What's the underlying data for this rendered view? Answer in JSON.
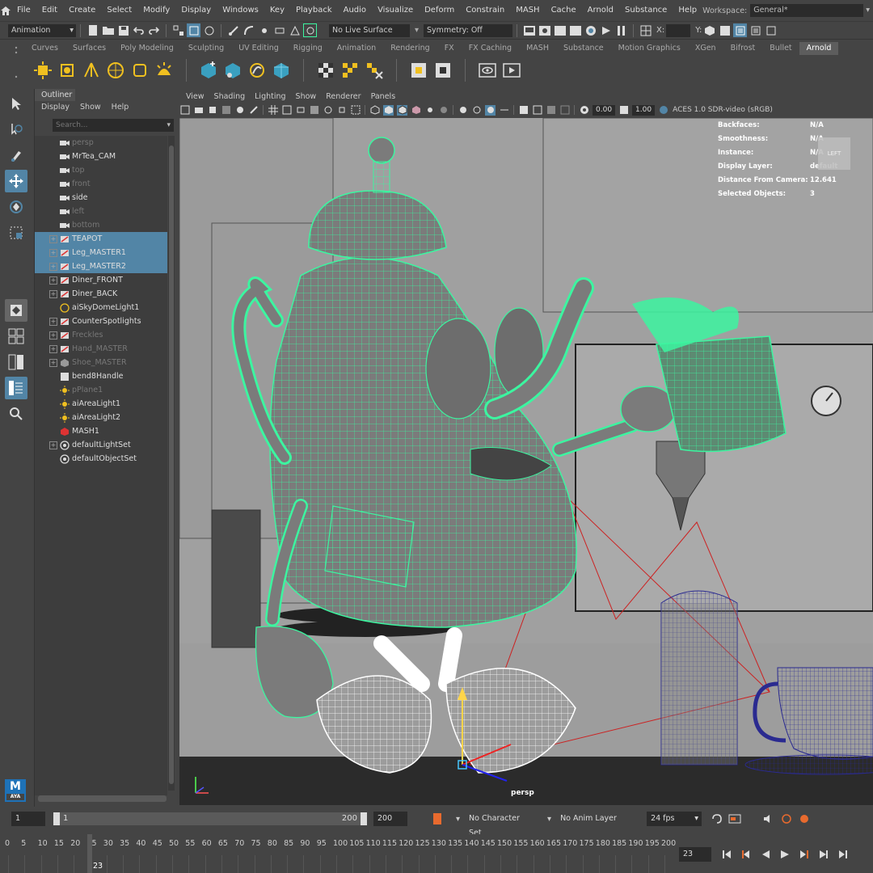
{
  "menubar": {
    "items": [
      "File",
      "Edit",
      "Create",
      "Select",
      "Modify",
      "Display",
      "Windows",
      "Key",
      "Playback",
      "Audio",
      "Visualize",
      "Deform",
      "Constrain",
      "MASH",
      "Cache",
      "Arnold",
      "Substance",
      "Help"
    ],
    "workspace_label": "Workspace:",
    "workspace_value": "General*"
  },
  "statusline": {
    "mode": "Animation",
    "live_surface": "No Live Surface",
    "symmetry": "Symmetry: Off",
    "x_label": "X:",
    "y_label": "Y:"
  },
  "shelf": {
    "tabs": [
      "Curves",
      "Surfaces",
      "Poly Modeling",
      "Sculpting",
      "UV Editing",
      "Rigging",
      "Animation",
      "Rendering",
      "FX",
      "FX Caching",
      "MASH",
      "Substance",
      "Motion Graphics",
      "XGen",
      "Bifrost",
      "Bullet",
      "Arnold"
    ],
    "active_tab": "Arnold"
  },
  "outliner": {
    "title": "Outliner",
    "menu": [
      "Display",
      "Show",
      "Help"
    ],
    "search_placeholder": "Search...",
    "items": [
      {
        "label": "persp",
        "icon": "camera-icon",
        "dim": true,
        "expand": false,
        "selected": false
      },
      {
        "label": "MrTea_CAM",
        "icon": "camera-icon",
        "dim": false,
        "expand": false,
        "selected": false
      },
      {
        "label": "top",
        "icon": "camera-icon",
        "dim": true,
        "expand": false,
        "selected": false
      },
      {
        "label": "front",
        "icon": "camera-icon",
        "dim": true,
        "expand": false,
        "selected": false
      },
      {
        "label": "side",
        "icon": "camera-icon",
        "dim": false,
        "expand": false,
        "selected": false
      },
      {
        "label": "left",
        "icon": "camera-icon",
        "dim": true,
        "expand": false,
        "selected": false
      },
      {
        "label": "bottom",
        "icon": "camera-icon",
        "dim": true,
        "expand": false,
        "selected": false
      },
      {
        "label": "TEAPOT",
        "icon": "group-icon",
        "dim": false,
        "expand": true,
        "selected": true
      },
      {
        "label": "Leg_MASTER1",
        "icon": "group-icon",
        "dim": false,
        "expand": true,
        "selected": true
      },
      {
        "label": "Leg_MASTER2",
        "icon": "group-icon",
        "dim": false,
        "expand": true,
        "selected": true
      },
      {
        "label": "Diner_FRONT",
        "icon": "group-icon",
        "dim": false,
        "expand": true,
        "selected": false
      },
      {
        "label": "Diner_BACK",
        "icon": "group-icon",
        "dim": false,
        "expand": true,
        "selected": false
      },
      {
        "label": "aiSkyDomeLight1",
        "icon": "skydome-icon",
        "dim": false,
        "expand": false,
        "selected": false
      },
      {
        "label": "CounterSpotlights",
        "icon": "group-icon",
        "dim": false,
        "expand": true,
        "selected": false
      },
      {
        "label": "Freckles",
        "icon": "group-icon",
        "dim": true,
        "expand": true,
        "selected": false
      },
      {
        "label": "Hand_MASTER",
        "icon": "group-icon",
        "dim": true,
        "expand": true,
        "selected": false
      },
      {
        "label": "Shoe_MASTER",
        "icon": "mesh-icon",
        "dim": true,
        "expand": true,
        "selected": false
      },
      {
        "label": "bend8Handle",
        "icon": "deformer-icon",
        "dim": false,
        "expand": false,
        "selected": false
      },
      {
        "label": "pPlane1",
        "icon": "light-icon",
        "dim": true,
        "expand": false,
        "selected": false
      },
      {
        "label": "aiAreaLight1",
        "icon": "light-icon",
        "dim": false,
        "expand": false,
        "selected": false
      },
      {
        "label": "aiAreaLight2",
        "icon": "light-icon",
        "dim": false,
        "expand": false,
        "selected": false
      },
      {
        "label": "MASH1",
        "icon": "mash-icon",
        "dim": false,
        "expand": false,
        "selected": false
      },
      {
        "label": "defaultLightSet",
        "icon": "set-icon",
        "dim": false,
        "expand": true,
        "selected": false
      },
      {
        "label": "defaultObjectSet",
        "icon": "set-icon",
        "dim": false,
        "expand": false,
        "selected": false
      }
    ]
  },
  "viewport": {
    "menu": [
      "View",
      "Shading",
      "Lighting",
      "Show",
      "Renderer",
      "Panels"
    ],
    "exposure": "0.00",
    "gamma": "1.00",
    "color_space": "ACES 1.0 SDR-video (sRGB)",
    "camera_label": "persp",
    "viewcube_label": "LEFT",
    "hud": [
      {
        "key": "Backfaces:",
        "value": "N/A"
      },
      {
        "key": "Smoothness:",
        "value": "N/A"
      },
      {
        "key": "Instance:",
        "value": "N/A"
      },
      {
        "key": "Display Layer:",
        "value": "default"
      },
      {
        "key": "Distance From Camera:",
        "value": "12.641"
      },
      {
        "key": "Selected Objects:",
        "value": "3"
      }
    ]
  },
  "timeline": {
    "start": "1",
    "range_start": "1",
    "range_end": "200",
    "end": "200",
    "character_set": "No Character Set",
    "anim_layer": "No Anim Layer",
    "fps": "24 fps",
    "ticks": [
      "0",
      "5",
      "10",
      "15",
      "20",
      "25",
      "30",
      "35",
      "40",
      "45",
      "50",
      "55",
      "60",
      "65",
      "70",
      "75",
      "80",
      "85",
      "90",
      "95",
      "100",
      "105",
      "110",
      "115",
      "120",
      "125",
      "130",
      "135",
      "140",
      "145",
      "150",
      "155",
      "160",
      "165",
      "170",
      "175",
      "180",
      "185",
      "190",
      "195",
      "200"
    ],
    "current_frame": "23",
    "current_frame_field": "23"
  },
  "colors": {
    "selection_blue": "#5285a6",
    "wire_green": "#3cf5a0",
    "wire_white": "#ffffff"
  }
}
